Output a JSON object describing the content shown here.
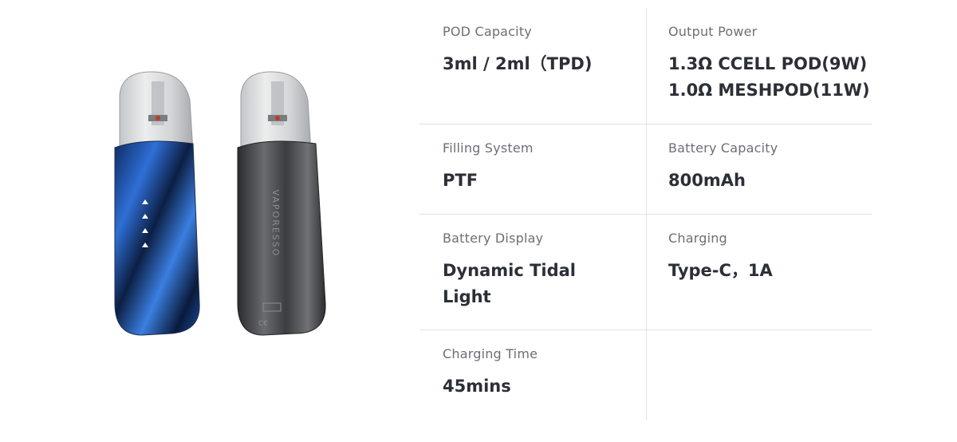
{
  "product": {
    "devices": [
      "blue-device",
      "grey-device"
    ],
    "brand_mark": "VAPORESSO",
    "colors": {
      "blue_body": "#1b4ea8",
      "dark_body": "#4a4b4e",
      "pod": "#d9dadc"
    }
  },
  "specs": [
    {
      "label": "POD Capacity",
      "value_lines": [
        "3ml / 2ml（TPD)"
      ]
    },
    {
      "label": "Output Power",
      "value_lines": [
        "1.3Ω CCELL POD(9W)",
        "1.0Ω MESHPOD(11W)"
      ]
    },
    {
      "label": "Filling System",
      "value_lines": [
        "PTF"
      ]
    },
    {
      "label": "Battery Capacity",
      "value_lines": [
        "800mAh"
      ]
    },
    {
      "label": "Battery Display",
      "value_lines": [
        "Dynamic Tidal",
        "Light"
      ]
    },
    {
      "label": "Charging",
      "value_lines": [
        "Type-C，1A"
      ]
    },
    {
      "label": "Charging Time",
      "value_lines": [
        "45mins"
      ]
    }
  ]
}
